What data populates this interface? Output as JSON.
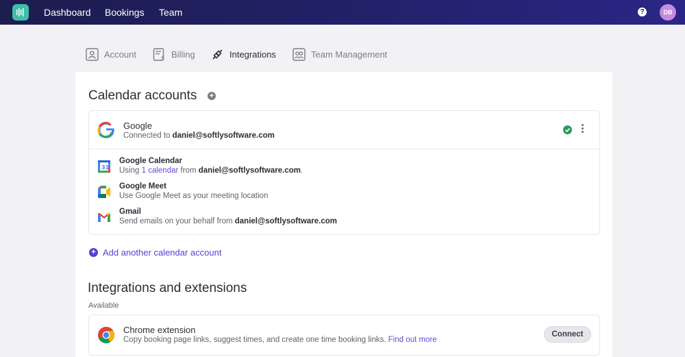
{
  "nav": {
    "links": [
      "Dashboard",
      "Bookings",
      "Team"
    ],
    "help_icon": "question-circle-icon",
    "avatar_initials": "DB"
  },
  "tabs": [
    {
      "label": "Account",
      "icon": "user-square-icon",
      "active": false
    },
    {
      "label": "Billing",
      "icon": "invoice-icon",
      "active": false
    },
    {
      "label": "Integrations",
      "icon": "plug-icon",
      "active": true
    },
    {
      "label": "Team Management",
      "icon": "team-icon",
      "active": false
    }
  ],
  "calendar": {
    "title": "Calendar accounts",
    "account": {
      "provider": "Google",
      "connected_prefix": "Connected to ",
      "email": "daniel@softlysoftware.com",
      "status_color": "#2b9a5b"
    },
    "services": [
      {
        "name": "Google Calendar",
        "desc_prefix": "Using ",
        "desc_link": "1 calendar",
        "desc_middle": " from ",
        "desc_bold": "daniel@softlysoftware.com",
        "desc_suffix": "."
      },
      {
        "name": "Google Meet",
        "desc": "Use Google Meet as your meeting location"
      },
      {
        "name": "Gmail",
        "desc_prefix": "Send emails on your behalf from ",
        "desc_bold": "daniel@softlysoftware.com"
      }
    ],
    "add_account_label": "Add another calendar account"
  },
  "integrations": {
    "title": "Integrations and extensions",
    "available_label": "Available",
    "chrome": {
      "name": "Chrome extension",
      "desc": "Copy booking page links, suggest times, and create one time booking links. ",
      "link": "Find out more",
      "button": "Connect"
    }
  },
  "colors": {
    "accent": "#5b3fd0",
    "topbar": "#22216a",
    "logo": "#3fbfa8"
  }
}
